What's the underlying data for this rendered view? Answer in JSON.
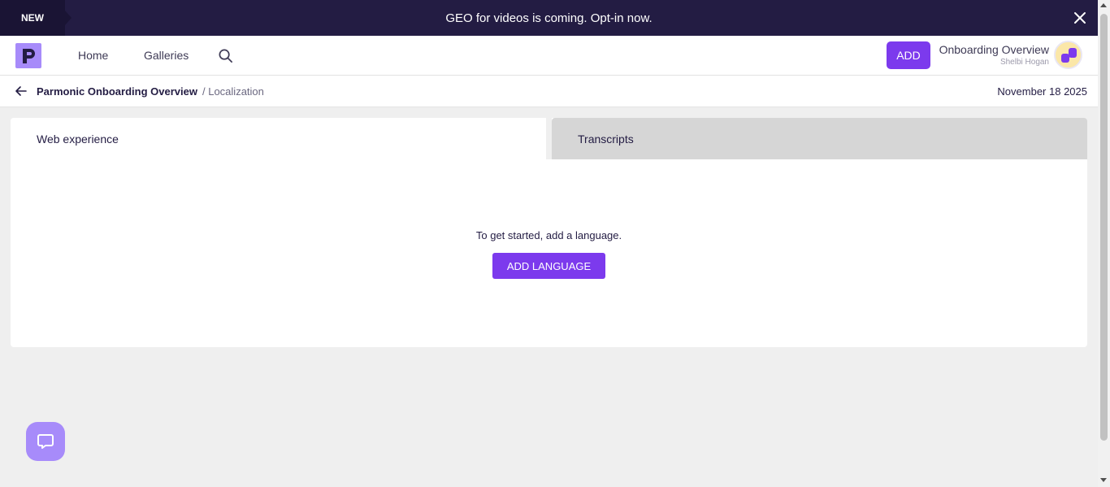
{
  "announcement": {
    "badge": "NEW",
    "text": "GEO for videos is coming. Opt-in now."
  },
  "nav": {
    "logo_letter": "P",
    "links": [
      "Home",
      "Galleries"
    ],
    "add_label": "ADD",
    "project_title": "Onboarding Overview",
    "user_name": "Shelbi Hogan"
  },
  "breadcrumb": {
    "main": "Parmonic Onboarding Overview",
    "sub": "/ Localization",
    "date": "November 18 2025"
  },
  "tabs": [
    {
      "label": "Web experience",
      "active": true
    },
    {
      "label": "Transcripts",
      "active": false
    }
  ],
  "empty_state": {
    "message": "To get started, add a language.",
    "button_label": "ADD LANGUAGE"
  },
  "colors": {
    "accent": "#7c3aed",
    "announce_bg": "#231c43",
    "logo_bg": "#a78bfa"
  }
}
